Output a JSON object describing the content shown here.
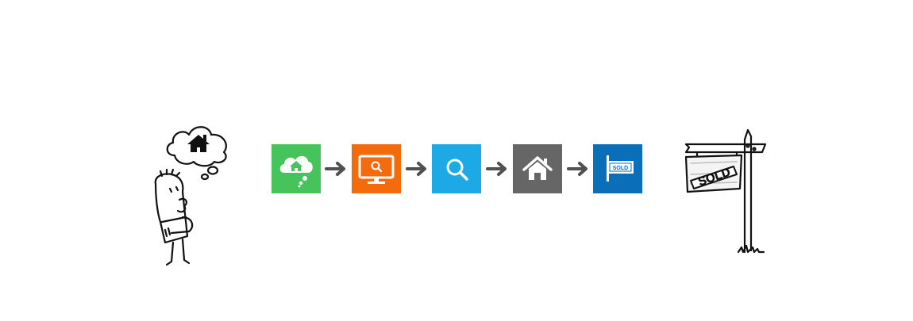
{
  "diagram": {
    "steps": [
      {
        "name": "dream-home",
        "icon": "cloud-house-icon",
        "color": "#46c35a"
      },
      {
        "name": "online-search",
        "icon": "monitor-search-icon",
        "color": "#f46b0d"
      },
      {
        "name": "search",
        "icon": "magnifier-icon",
        "color": "#1da9e6"
      },
      {
        "name": "home",
        "icon": "house-icon",
        "color": "#666666"
      },
      {
        "name": "sold",
        "icon": "sold-sign-icon",
        "color": "#0a6fb8"
      }
    ],
    "connector_icon": "arrow-right-icon",
    "connector_color": "#505050",
    "left_figure_icon": "thinking-man-icon",
    "right_figure_icon": "sold-sign-post-icon",
    "tile_sold_label": "SOLD",
    "sign_sold_label": "SOLD"
  }
}
